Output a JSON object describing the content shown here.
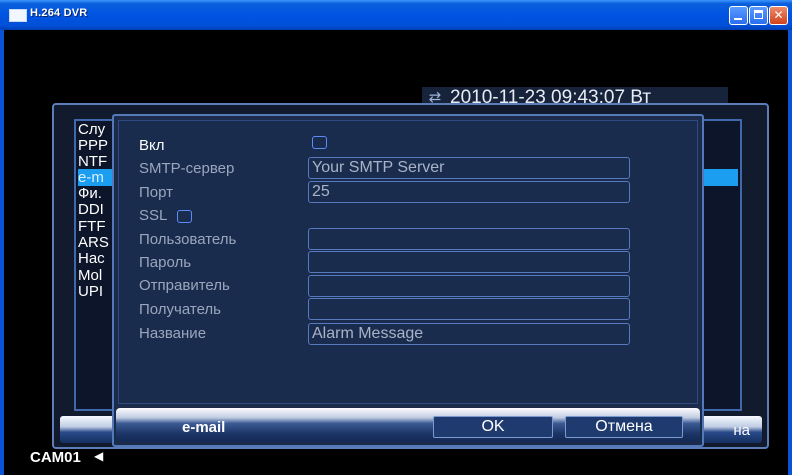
{
  "window": {
    "title": "H.264 DVR",
    "min_icon": "minimize-icon",
    "max_icon": "maximize-icon",
    "close_icon": "close-icon",
    "close_glyph": "✕"
  },
  "datetime": {
    "icon": "sync-icon",
    "glyph": "⇄",
    "text": "2010-11-23 09:43:07 Вт"
  },
  "network_menu": {
    "items": [
      "Слу",
      "PPP",
      "NTF",
      "e-m",
      "Фи.",
      "DDI",
      "FTF",
      "ARS",
      "Hac",
      "Mol",
      "UPI"
    ],
    "selected_index": 3,
    "cancel_label": "на"
  },
  "email_dialog": {
    "enable": {
      "label": "Вкл",
      "checked": false
    },
    "smtp_server": {
      "label": "SMTP-сервер",
      "value": "Your SMTP Server"
    },
    "port": {
      "label": "Порт",
      "value": "25"
    },
    "ssl": {
      "label": "SSL",
      "checked": false
    },
    "user": {
      "label": "Пользователь",
      "value": ""
    },
    "password": {
      "label": "Пароль",
      "value": ""
    },
    "sender": {
      "label": "Отправитель",
      "value": ""
    },
    "receiver": {
      "label": "Получатель",
      "value": ""
    },
    "subject": {
      "label": "Название",
      "value": "Alarm Message"
    },
    "bar_title": "e-mail",
    "ok_label": "OK",
    "cancel_label": "Отмена"
  },
  "footer": {
    "camera": "CAM01",
    "speaker_icon": "speaker-icon",
    "speaker_glyph": "◀"
  },
  "colors": {
    "titlebar": "#0054e3",
    "dialog_bg": "#1b2b49",
    "field_border": "#5779be",
    "selected_item": "#1b9df0",
    "highlight_strip": "#f0c22e"
  }
}
